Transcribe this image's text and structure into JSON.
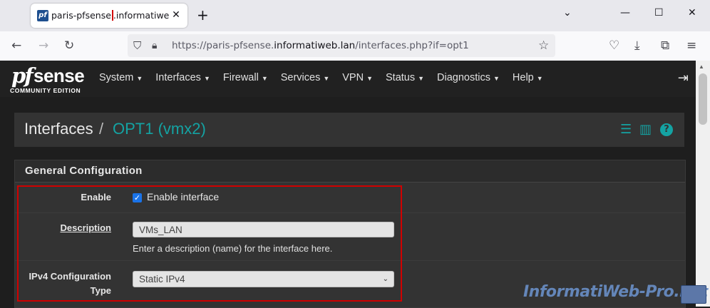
{
  "browser": {
    "tab": {
      "title_highlight": "paris-pfsense",
      "title_rest": ".informatiweb.lan",
      "favicon": "pf"
    },
    "url_prefix": "https://paris-pfsense.",
    "url_domain": "informatiweb.lan",
    "url_path": "/interfaces.php?if=opt1",
    "icons": [
      "back-icon",
      "forward-icon",
      "reload-icon",
      "shield-icon",
      "lock-icon",
      "star-icon",
      "pocket-icon",
      "download-icon",
      "extensions-icon",
      "menu-icon"
    ]
  },
  "header": {
    "logo_pf": "pf",
    "logo_sense": "sense",
    "logo_edition": "COMMUNITY EDITION",
    "menu": [
      "System",
      "Interfaces",
      "Firewall",
      "Services",
      "VPN",
      "Status",
      "Diagnostics",
      "Help"
    ]
  },
  "page": {
    "breadcrumb_root": "Interfaces",
    "breadcrumb_sep": "/",
    "breadcrumb_current": "OPT1 (vmx2)",
    "accent": "#14a3a3"
  },
  "panel": {
    "title": "General Configuration",
    "enable": {
      "label": "Enable",
      "checkbox_label": "Enable interface",
      "checked": true
    },
    "description": {
      "label": "Description",
      "value": "VMs_LAN",
      "help": "Enter a description (name) for the interface here."
    },
    "ipv4": {
      "label_line1": "IPv4 Configuration",
      "label_line2": "Type",
      "value": "Static IPv4"
    }
  },
  "watermark": "InformatiWeb-Pro.net"
}
